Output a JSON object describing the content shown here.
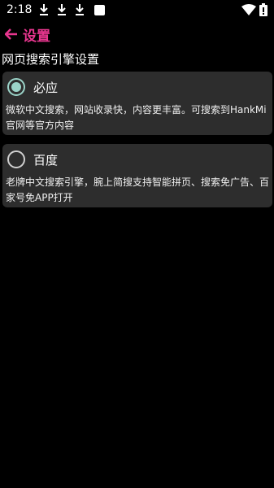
{
  "status_bar": {
    "time": "2:18",
    "notification_icons": [
      "download-icon",
      "download-icon",
      "download-icon",
      "app-square-icon"
    ],
    "system_icons": [
      "wifi-icon",
      "battery-alert-icon"
    ]
  },
  "app_bar": {
    "back_icon": "arrow-left-icon",
    "title": "设置",
    "accent_color": "#e8368f"
  },
  "section": {
    "heading": "网页搜索引擎设置"
  },
  "options": [
    {
      "label": "必应",
      "selected": true,
      "description": "微软中文搜索，网站收录快，内容更丰富。可搜索到HankMi官网等官方内容"
    },
    {
      "label": "百度",
      "selected": false,
      "description": "老牌中文搜索引擎，腕上简搜支持智能拼页、搜索免广告、百家号免APP打开"
    }
  ],
  "colors": {
    "background": "#000000",
    "card": "#2d2d2d",
    "radio_selected": "#9bd3c8"
  }
}
